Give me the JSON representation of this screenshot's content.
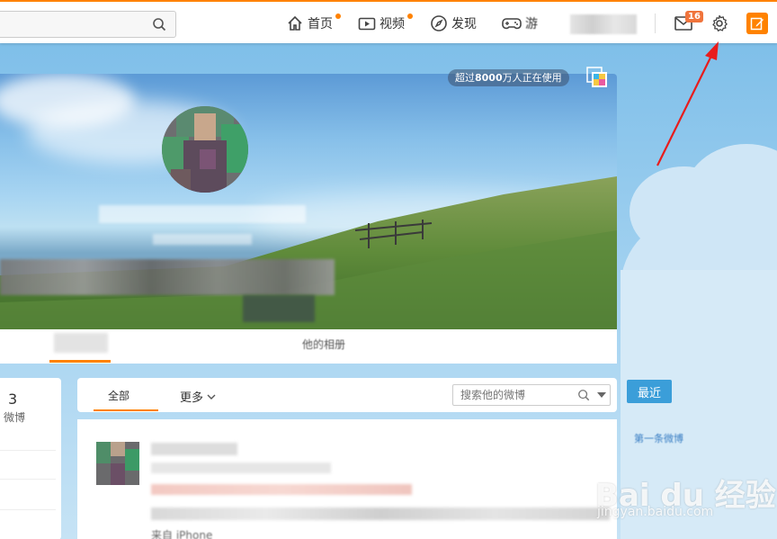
{
  "topbar": {
    "search_placeholder": "",
    "nav": [
      {
        "label": "首页",
        "icon": "home-icon",
        "has_dot": true
      },
      {
        "label": "视频",
        "icon": "video-icon",
        "has_dot": true
      },
      {
        "label": "发现",
        "icon": "compass-icon",
        "has_dot": false
      },
      {
        "label": "游",
        "icon": "gamepad-icon",
        "has_dot": false
      }
    ],
    "message_count": "16",
    "accent": "#ff8200"
  },
  "cover": {
    "usage_prefix": "超过",
    "usage_number": "8000",
    "usage_suffix": "万人正在使用",
    "album_label": "他的相册"
  },
  "profile": {
    "weibo_count": "3",
    "weibo_count_label": "微博"
  },
  "feed": {
    "tab_all": "全部",
    "tab_more": "更多",
    "search_placeholder": "搜索他的微博",
    "post_footer_text": "来自 iPhone"
  },
  "sidebar": {
    "recent_label": "最近",
    "side_link": "第一条微博"
  },
  "watermark": {
    "text": "Bai du 经验",
    "url": "jingyan.baidu.com"
  }
}
